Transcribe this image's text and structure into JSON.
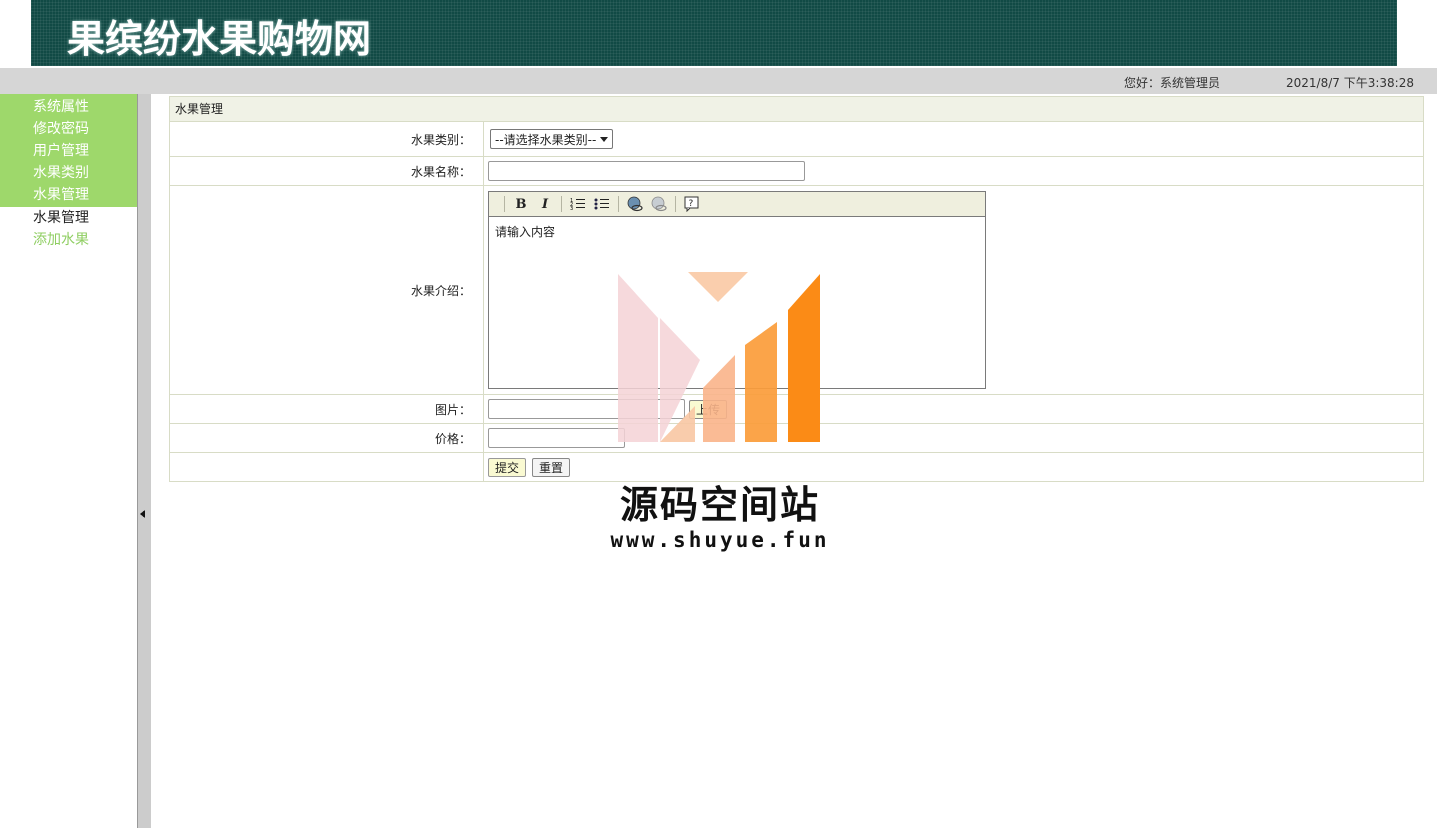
{
  "header": {
    "site_title": "果缤纷水果购物网"
  },
  "status": {
    "greeting": "您好：系统管理员",
    "datetime": "2021/8/7 下午3:38:28"
  },
  "sidebar": {
    "groups": [
      {
        "label": "系统属性"
      },
      {
        "label": "修改密码"
      },
      {
        "label": "用户管理"
      },
      {
        "label": "水果类别"
      },
      {
        "label": "水果管理"
      }
    ],
    "submenu_title": "水果管理",
    "submenu_link": "添加水果"
  },
  "panel": {
    "title": "水果管理",
    "fields": {
      "category_label": "水果类别：",
      "category_selected": "--请选择水果类别--",
      "name_label": "水果名称：",
      "name_value": "",
      "intro_label": "水果介绍：",
      "intro_placeholder": "请输入内容",
      "image_label": "图片：",
      "image_value": "",
      "upload_label": "上传",
      "price_label": "价格：",
      "price_value": ""
    },
    "buttons": {
      "submit": "提交",
      "reset": "重置"
    },
    "toolbar": {
      "bold": "B",
      "italic": "I"
    }
  },
  "watermark": {
    "title": "源码空间站",
    "url": "www.shuyue.fun",
    "colors": [
      "#f4d2d6",
      "#f9b48a",
      "#fb8b16"
    ]
  },
  "colors": {
    "banner": "#114a45",
    "sidebar_active": "#9ed86b",
    "link": "#8fce62",
    "statusbar": "#d6d6d6",
    "panel_head": "#f0f2e6"
  }
}
